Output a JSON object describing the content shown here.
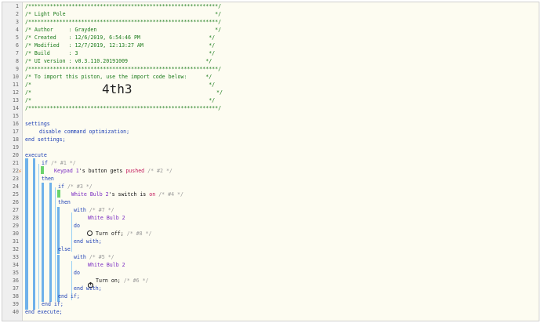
{
  "header": {
    "border_top": "/*************************************************************/",
    "title": "/* Light Pole                                                */",
    "author": "/* Author     : Grayden                                      */",
    "created": "/* Created    : 12/6/2019, 6:54:46 PM                      */",
    "modified": "/* Modified   : 12/7/2019, 12:13:27 AM                     */",
    "build": "/* Build      : 3                                          */",
    "ui_version": "/* UI version : v0.3.110.20191009                         */",
    "import_note": "/* To import this piston, use the import code below:      */",
    "blank": "/*                                                         */",
    "import_prefix": "/*",
    "import_code": "4th3",
    "import_suffix": "*/"
  },
  "line_numbers": [
    "1",
    "2",
    "3",
    "4",
    "5",
    "6",
    "7",
    "8",
    "9",
    "10",
    "11",
    "12",
    "13",
    "14",
    "15",
    "16",
    "17",
    "18",
    "19",
    "20",
    "21",
    "22",
    "23",
    "24",
    "25",
    "26",
    "27",
    "28",
    "29",
    "30",
    "31",
    "32",
    "33",
    "34",
    "35",
    "36",
    "37",
    "38",
    "39",
    "40"
  ],
  "settings": {
    "keyword": "settings",
    "option": "disable command optimization;",
    "end": "end settings;"
  },
  "execute": {
    "keyword": "execute",
    "end": "end execute;",
    "if1": {
      "if": "if",
      "comment": "/* #1 */",
      "then": "then",
      "end": "end if;"
    },
    "condition1": {
      "device": "Keypad 1",
      "attr": "'s button gets",
      "value": "pushed",
      "comment": "/* #2 */"
    },
    "if2": {
      "if": "if",
      "comment": "/* #3 */",
      "then": "then",
      "else": "else",
      "end": "end if;"
    },
    "condition2": {
      "device": "White Bulb 2",
      "attr": "'s switch is",
      "value": "on",
      "comment": "/* #4 */"
    },
    "with1": {
      "with": "with",
      "comment": "/* #7 */",
      "device": "White Bulb 2",
      "do": "do",
      "action": "Turn off;",
      "action_comment": "/* #8 */",
      "end": "end with;"
    },
    "with2": {
      "with": "with",
      "comment": "/* #5 */",
      "device": "White Bulb 2",
      "do": "do",
      "action": "Turn on;",
      "action_comment": "/* #6 */",
      "end": "end with;"
    }
  },
  "icons": {
    "trigger": "lightning-bolt-icon",
    "power_off": "power-off-icon",
    "power_on": "power-on-icon"
  },
  "colors": {
    "background": "#fdfcf1",
    "comment": "#1a7a1a",
    "keyword": "#1d3fb5",
    "device": "#7a2bc2",
    "bar": "#6fb1ea",
    "condition_marker": "#6bd36b",
    "trigger": "#e67e22"
  }
}
